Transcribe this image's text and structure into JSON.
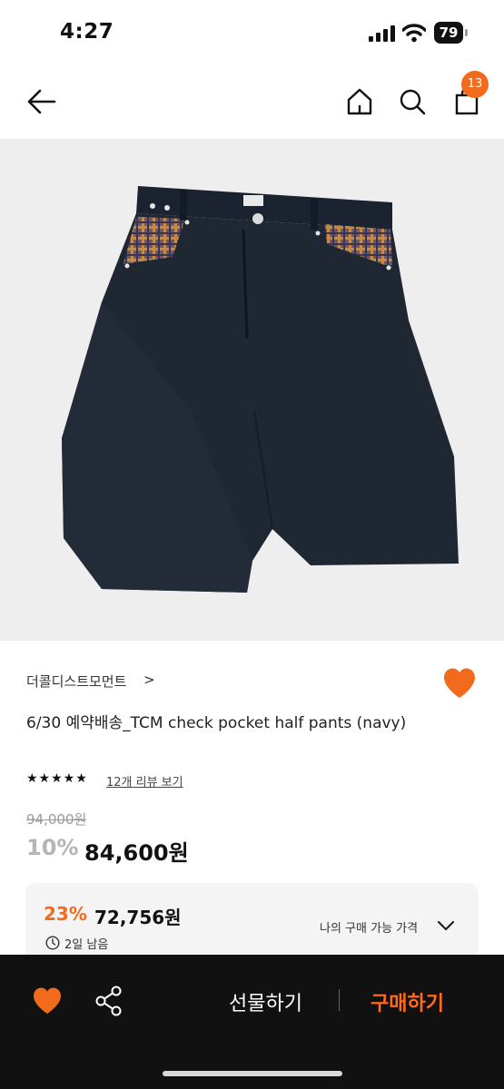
{
  "status_bar": {
    "time": "4:27",
    "battery": "79"
  },
  "header": {
    "cart_count": "13"
  },
  "product": {
    "brand": "더콜디스트모먼트",
    "brand_chevron": ">",
    "title": "6/30 예약배송_TCM check pocket half pants (navy)",
    "stars": "★★★★★",
    "review_link": "12개 리뷰 보기",
    "original_price": "94,000원",
    "discount_rate": "10%",
    "price": "84,600원"
  },
  "coupon": {
    "discount_rate": "23%",
    "price": "72,756원",
    "my_price_label": "나의 구매 가능 가격",
    "remaining": "2일 남음"
  },
  "bottom_bar": {
    "gift_label": "선물하기",
    "buy_label": "구매하기"
  },
  "colors": {
    "accent": "#f26b1d",
    "bottom_bg": "#111111",
    "pants": "#1f2733"
  }
}
